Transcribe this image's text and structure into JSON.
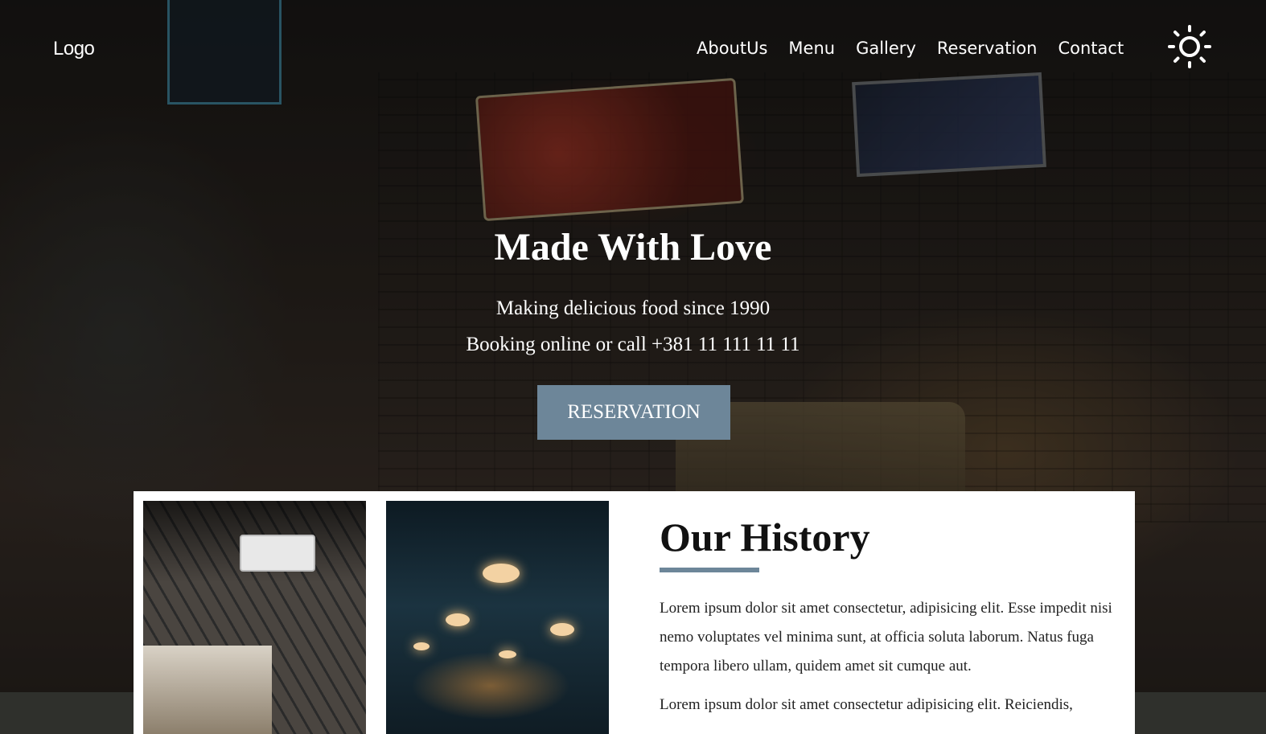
{
  "nav": {
    "logo": "Logo",
    "links": [
      "AboutUs",
      "Menu",
      "Gallery",
      "Reservation",
      "Contact"
    ],
    "theme_icon": "sun-icon"
  },
  "hero": {
    "title": "Made With Love",
    "subtitle": "Making delicious food since 1990",
    "booking": "Booking online or call +381 11 111 11 11",
    "button": "RESERVATION"
  },
  "history": {
    "title": "Our History",
    "p1": "Lorem ipsum dolor sit amet consectetur, adipisicing elit. Esse impedit nisi nemo voluptates vel minima sunt, at officia soluta laborum. Natus fuga tempora libero ullam, quidem amet sit cumque aut.",
    "p2": "Lorem ipsum dolor sit amet consectetur adipisicing elit. Reiciendis,"
  },
  "colors": {
    "accent": "#6d8699",
    "text_dark": "#111111",
    "footer_band": "#2f302c"
  }
}
